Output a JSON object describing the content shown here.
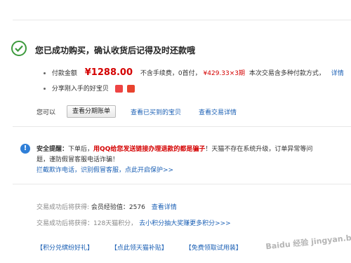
{
  "success": {
    "title": "您已成功购买，确认收货后记得及时还款哦"
  },
  "payment": {
    "label": "付款金额",
    "amount": "¥1288.00",
    "fee_text": "不含手续费，0首付，",
    "installment": "¥429.33×3期",
    "installment_note": "本次交易含多种付款方式，",
    "details_link": "详情"
  },
  "share": {
    "label": "分享刚入手的好宝贝",
    "icons": [
      "picture-share-icon",
      "weibo-icon"
    ]
  },
  "actions": {
    "label": "您可以",
    "view_installment_button": "查看分期账单",
    "view_bought_link": "查看已买到的宝贝",
    "view_trade_link": "查看交易详情"
  },
  "security": {
    "prefix": "安全提醒：",
    "text1": "下单后，",
    "warning": "用QQ给您发送链接办理退款的都是骗子",
    "text2": "！天猫不存在系统升级，订单异常等问",
    "line2": "题，谨防假冒客服电话诈骗！",
    "protection_link": "拦截欺诈电话，识别假冒客服，点此开启保护>>"
  },
  "rewards": {
    "exp_label": "交易成功后将获得:",
    "exp_text": "会员经验值：2576",
    "exp_link": "查看详情",
    "points_text": "交易成功后将获得：128天猫积分，",
    "points_link": "去小积分抽大奖赚更多积分>>>"
  },
  "bottom_links": [
    "【积分兑缤纷好礼】",
    "【点此领天猫补贴】",
    "【免费领取试用装】"
  ],
  "watermark": "Baidu 经验 jingyan.baidu.com"
}
